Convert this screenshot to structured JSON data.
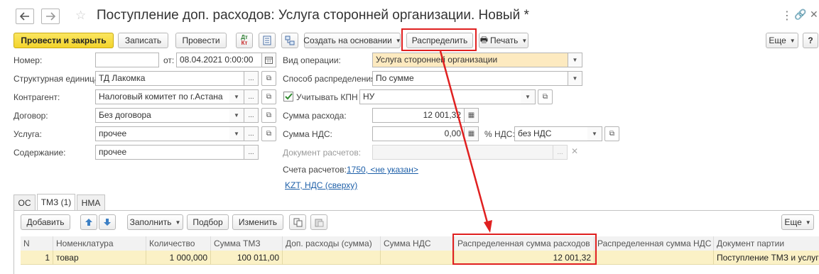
{
  "window": {
    "title": "Поступление доп. расходов: Услуга сторонней организации. Новый *",
    "back_icon": "arrow-left-icon",
    "forward_icon": "arrow-right-icon",
    "star_icon": "star-icon",
    "menu_icon": "more-vert-icon",
    "link_icon": "link-icon",
    "close_label": "✕"
  },
  "toolbar": {
    "post_close": "Провести и закрыть",
    "save": "Записать",
    "post": "Провести",
    "dtkt": "Дт Кт",
    "create_based": "Создать на основании",
    "distribute": "Распределить",
    "print": "Печать",
    "more": "Еще",
    "help": "?"
  },
  "form": {
    "number_label": "Номер:",
    "number_value": "",
    "date_from_label": "от:",
    "date_value": "08.04.2021  0:00:00",
    "unit_label": "Структурная единица:",
    "unit_value": "ТД Лакомка",
    "contractor_label": "Контрагент:",
    "contractor_value": "Налоговый комитет по г.Астана",
    "contract_label": "Договор:",
    "contract_value": "Без договора",
    "service_label": "Услуга:",
    "service_value": "прочее",
    "content_label": "Содержание:",
    "content_value": "прочее",
    "op_type_label": "Вид операции:",
    "op_type_value": "Услуга сторонней организации",
    "dist_method_label": "Способ распределения:",
    "dist_method_value": "По сумме",
    "kpn_label": "Учитывать КПН",
    "kpn_value": "НУ",
    "expense_sum_label": "Сумма расхода:",
    "expense_sum_value": "12 001,32",
    "vat_sum_label": "Сумма НДС:",
    "vat_sum_value": "0,00",
    "vat_rate_label": "% НДС:",
    "vat_rate_value": "без НДС",
    "settlement_doc_label": "Документ расчетов:",
    "settlement_doc_value": "",
    "accounts_label": "Счета расчетов:",
    "accounts_link": "1750, <не указан>",
    "currency_link": "KZT, НДС (сверху)"
  },
  "tabs": [
    "ОС",
    "ТМЗ (1)",
    "НМА"
  ],
  "table_toolbar": {
    "add": "Добавить",
    "fill": "Заполнить",
    "select": "Подбор",
    "change": "Изменить",
    "more": "Еще"
  },
  "table": {
    "columns": [
      "N",
      "Номенклатура",
      "Количество",
      "Сумма ТМЗ",
      "Доп. расходы (сумма)",
      "Сумма НДС",
      "Распределенная сумма расходов",
      "Распределенная сумма НДС",
      "Документ партии"
    ],
    "rows": [
      [
        "1",
        "товар",
        "1 000,000",
        "100 011,00",
        "",
        "",
        "12 001,32",
        "",
        "Поступление ТМЗ и услуг"
      ]
    ]
  }
}
